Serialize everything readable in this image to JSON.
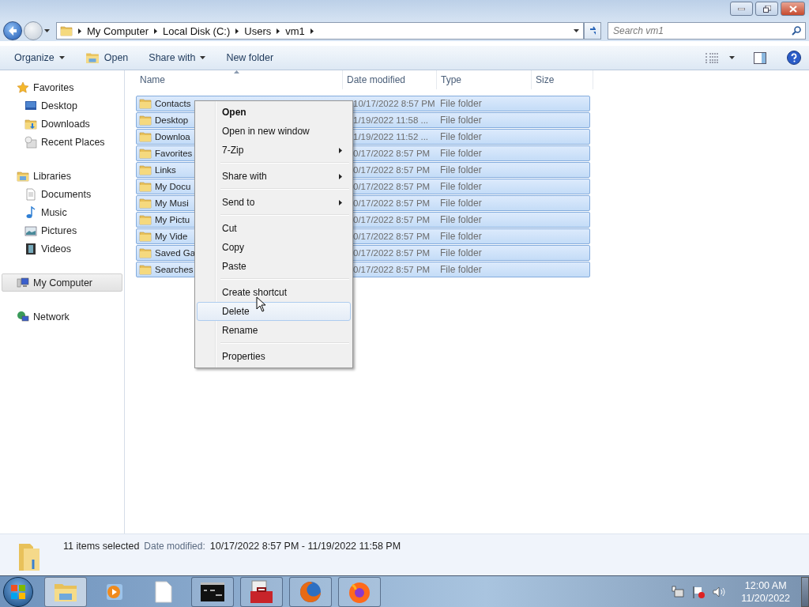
{
  "address_bar": {
    "breadcrumbs": [
      "My Computer",
      "Local Disk (C:)",
      "Users",
      "vm1"
    ]
  },
  "search": {
    "placeholder": "Search vm1"
  },
  "toolbar": {
    "buttons": [
      {
        "label": "Organize",
        "kind": "menu"
      },
      {
        "label": "Open",
        "kind": "icon"
      },
      {
        "label": "Share with",
        "kind": "menu"
      },
      {
        "label": "New folder",
        "kind": "plain"
      }
    ]
  },
  "sidebar": {
    "groups": [
      {
        "label": "Favorites",
        "kind": "star",
        "selected": false,
        "children": [
          {
            "label": "Desktop",
            "kind": "desktop",
            "selected": false
          },
          {
            "label": "Downloads",
            "kind": "download",
            "selected": false
          },
          {
            "label": "Recent Places",
            "kind": "recent",
            "selected": false
          }
        ]
      },
      {
        "label": "Libraries",
        "kind": "library",
        "selected": false,
        "children": [
          {
            "label": "Documents",
            "kind": "document",
            "selected": false
          },
          {
            "label": "Music",
            "kind": "music",
            "selected": false
          },
          {
            "label": "Pictures",
            "kind": "picture",
            "selected": false
          },
          {
            "label": "Videos",
            "kind": "video",
            "selected": false
          }
        ]
      },
      {
        "label": "My Computer",
        "kind": "computer",
        "selected": true
      },
      {
        "label": "Network",
        "kind": "network",
        "selected": false
      }
    ]
  },
  "table": {
    "columns": [
      "Name",
      "Date modified",
      "Type",
      "Size"
    ],
    "rows": [
      {
        "name": "Contacts",
        "date": "10/17/2022 8:57 PM",
        "type": "File folder",
        "selected": true
      },
      {
        "name": "Desktop",
        "date": "1/19/2022 11:58 ...",
        "type": "File folder",
        "selected": true
      },
      {
        "name": "Downloa",
        "date": "1/19/2022 11:52 ...",
        "type": "File folder",
        "selected": true
      },
      {
        "name": "Favorites",
        "date": "0/17/2022 8:57 PM",
        "type": "File folder",
        "selected": true
      },
      {
        "name": "Links",
        "date": "0/17/2022 8:57 PM",
        "type": "File folder",
        "selected": true
      },
      {
        "name": "My Docu",
        "date": "0/17/2022 8:57 PM",
        "type": "File folder",
        "selected": true
      },
      {
        "name": "My Musi",
        "date": "0/17/2022 8:57 PM",
        "type": "File folder",
        "selected": true
      },
      {
        "name": "My Pictu",
        "date": "0/17/2022 8:57 PM",
        "type": "File folder",
        "selected": true
      },
      {
        "name": "My Vide",
        "date": "0/17/2022 8:57 PM",
        "type": "File folder",
        "selected": true
      },
      {
        "name": "Saved Ga",
        "date": "0/17/2022 8:57 PM",
        "type": "File folder",
        "selected": true
      },
      {
        "name": "Searches",
        "date": "0/17/2022 8:57 PM",
        "type": "File folder",
        "selected": true
      }
    ]
  },
  "context_menu": {
    "groups": [
      [
        {
          "label": "Open",
          "default": true,
          "submenu": false,
          "selected": false
        },
        {
          "label": "Open in new window",
          "default": false,
          "submenu": false,
          "selected": false
        },
        {
          "label": "7-Zip",
          "default": false,
          "submenu": true,
          "selected": false
        }
      ],
      [
        {
          "label": "Share with",
          "default": false,
          "submenu": true,
          "selected": false
        }
      ],
      [
        {
          "label": "Send to",
          "default": false,
          "submenu": true,
          "selected": false
        }
      ],
      [
        {
          "label": "Cut",
          "default": false,
          "submenu": false,
          "selected": false
        },
        {
          "label": "Copy",
          "default": false,
          "submenu": false,
          "selected": false
        },
        {
          "label": "Paste",
          "default": false,
          "submenu": false,
          "selected": false
        }
      ],
      [
        {
          "label": "Create shortcut",
          "default": false,
          "submenu": false,
          "selected": false
        },
        {
          "label": "Delete",
          "default": false,
          "submenu": false,
          "selected": true
        },
        {
          "label": "Rename",
          "default": false,
          "submenu": false,
          "selected": false
        }
      ],
      [
        {
          "label": "Properties",
          "default": false,
          "submenu": false,
          "selected": false
        }
      ]
    ]
  },
  "details": {
    "count": "11 items selected",
    "label": "Date modified:",
    "value": "10/17/2022 8:57 PM - 11/19/2022 11:58 PM"
  },
  "taskbar": {
    "apps": [
      {
        "kind": "explorer",
        "running": true,
        "active": true
      },
      {
        "kind": "media",
        "running": false,
        "active": false
      },
      {
        "kind": "document",
        "running": false,
        "active": false
      },
      {
        "kind": "terminal",
        "running": true,
        "active": false
      },
      {
        "kind": "toolbox",
        "running": true,
        "active": false
      },
      {
        "kind": "globe",
        "running": true,
        "active": false
      },
      {
        "kind": "fox",
        "running": true,
        "active": false
      }
    ],
    "clock": {
      "time": "12:00 AM",
      "date": "11/20/2022"
    }
  }
}
